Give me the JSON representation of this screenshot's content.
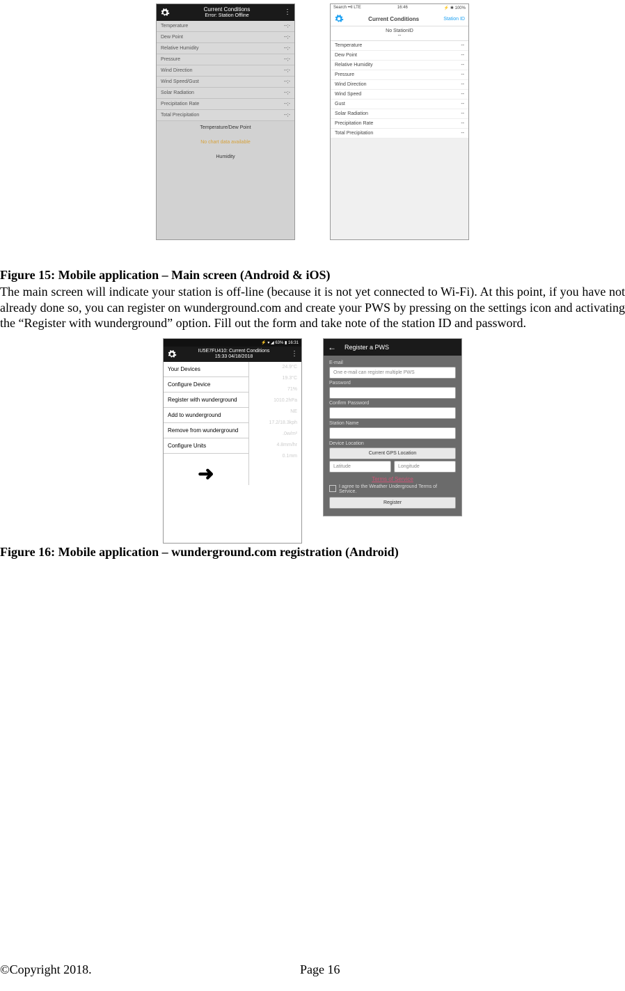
{
  "fig15": {
    "caption": "Figure 15: Mobile application – Main screen (Android & iOS)",
    "android": {
      "title": "Current Conditions",
      "subtitle": "Error: Station Offline",
      "rows": [
        {
          "label": "Temperature",
          "value": "--;-"
        },
        {
          "label": "Dew Point",
          "value": "--;-"
        },
        {
          "label": "Relative Humidity",
          "value": "--;-"
        },
        {
          "label": "Pressure",
          "value": "--;-"
        },
        {
          "label": "Wind Direction",
          "value": "--;-"
        },
        {
          "label": "Wind Speed/Gust",
          "value": "--;-"
        },
        {
          "label": "Solar Radiation",
          "value": "--;-"
        },
        {
          "label": "Precipitation Rate",
          "value": "--;-"
        },
        {
          "label": "Total Precipitation",
          "value": "--;-"
        }
      ],
      "chart1_label": "Temperature/Dew Point",
      "no_chart": "No chart data available",
      "chart2_label": "Humidity"
    },
    "ios": {
      "status_left": "Search ••ll LTE",
      "status_center": "16:46",
      "status_right": "⚡ ✱ 100%",
      "title": "Current Conditions",
      "link": "Station ID",
      "sub": "No StationID\n--",
      "rows": [
        {
          "label": "Temperature",
          "value": "--"
        },
        {
          "label": "Dew Point",
          "value": "--"
        },
        {
          "label": "Relative Humidity",
          "value": "--"
        },
        {
          "label": "Pressure",
          "value": "--"
        },
        {
          "label": "Wind Direction",
          "value": "--"
        },
        {
          "label": "Wind Speed",
          "value": "--"
        },
        {
          "label": "Gust",
          "value": "--"
        },
        {
          "label": "Solar Radiation",
          "value": "--"
        },
        {
          "label": "Precipitation Rate",
          "value": "--"
        },
        {
          "label": "Total Precipitation",
          "value": "--"
        }
      ]
    }
  },
  "para1": "The main screen will indicate your station is off-line (because it is not yet connected to Wi-Fi). At this point, if you have not already done so, you can register on wunderground.com and create your PWS by pressing on the settings icon and activating the “Register with wunderground” option. Fill out the form and take note of the station ID and password.",
  "fig16": {
    "caption": "Figure 16: Mobile application – wunderground.com registration (Android)",
    "menu": {
      "status": "⚡ ▾ ◢ 63% ▮ 16:31",
      "title1": "IU5E7FU410: Current Conditions",
      "title2": "15:33   04/18/2018",
      "items": [
        "Your Devices",
        "Configure Device",
        "Register with wunderground",
        "Add to wunderground",
        "Remove from wunderground",
        "Configure Units"
      ],
      "bg_values": [
        "24.9°C",
        "19.3°C",
        "71%",
        "1010.2hPa",
        "NE",
        "17.2/18.3kph",
        ".0w/m²",
        "4.8mm/hr",
        "0.1mm"
      ],
      "arrow": "➜"
    },
    "register": {
      "header": "Register a PWS",
      "email_label": "E-mail",
      "email_ph": "One e-mail can register multiple PWS",
      "pw_label": "Password",
      "cpw_label": "Confirm Password",
      "sn_label": "Station Name",
      "dl_label": "Device Location",
      "gps_btn": "Current GPS Location",
      "lat_ph": "Latitude",
      "lon_ph": "Longitude",
      "tos": "Terms of Service",
      "agree": "I agree to the Weather Underground Terms of Service.",
      "register_btn": "Register"
    }
  },
  "footer": {
    "copyright": "©Copyright 2018.",
    "page": "Page 16"
  }
}
